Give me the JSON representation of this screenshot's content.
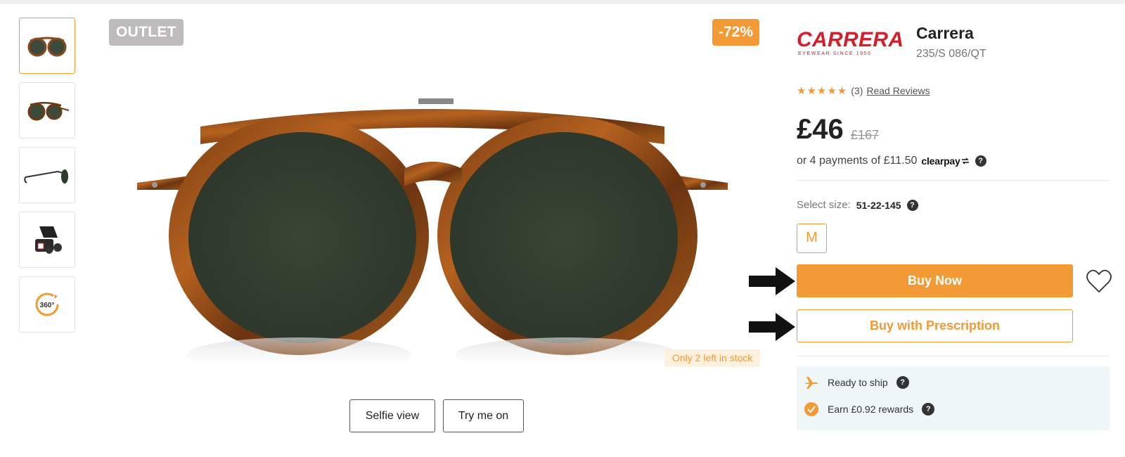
{
  "badges": {
    "outlet": "OUTLET",
    "discount": "-72%",
    "stock": "Only 2 left in stock"
  },
  "thumbnails": [
    {
      "icon": "glasses-front-thumbnail"
    },
    {
      "icon": "glasses-angle-thumbnail"
    },
    {
      "icon": "glasses-side-thumbnail"
    },
    {
      "icon": "glasses-case-thumbnail"
    },
    {
      "label": "360°"
    }
  ],
  "view_buttons": {
    "selfie": "Selfie view",
    "try_on": "Try me on"
  },
  "product": {
    "brand_logo_main": "CARRERA",
    "brand_logo_sub": "EYEWEAR SINCE 1956",
    "brand": "Carrera",
    "model": "235/S 086/QT",
    "stars": "★★★★★",
    "review_count": "(3)",
    "read_reviews": "Read Reviews",
    "price": "£46",
    "old_price": "£167",
    "payments": "or 4 payments of £11.50",
    "payment_provider": "clearpay",
    "size_label": "Select size:",
    "size_value": "51-22-145",
    "size_option": "M"
  },
  "actions": {
    "buy_now": "Buy Now",
    "buy_rx": "Buy with Prescription"
  },
  "info": {
    "ship": "Ready to ship",
    "rewards": "Earn £0.92 rewards",
    "help": "?"
  },
  "colors": {
    "accent": "#f29a36",
    "outlet": "#bdbbbb",
    "info_bg": "#eef6f8"
  }
}
